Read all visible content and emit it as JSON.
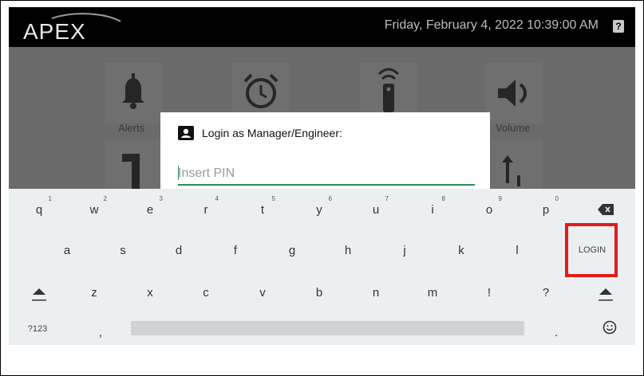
{
  "header": {
    "logo_text": "APEX",
    "datetime": "Friday, February 4, 2022 10:39:00 AM",
    "help_icon": "?"
  },
  "background_tiles": [
    {
      "icon": "bell-icon",
      "label": "Alerts"
    },
    {
      "icon": "alarm-clock-icon",
      "label": ""
    },
    {
      "icon": "remote-icon",
      "label": ""
    },
    {
      "icon": "volume-icon",
      "label": "Volume"
    },
    {
      "icon": "music-note-icon",
      "label": ""
    },
    {
      "icon": "sort-icon",
      "label": ""
    }
  ],
  "dialog": {
    "title": "Login as Manager/Engineer:",
    "icon": "person-badge-icon",
    "pin_placeholder": "Insert PIN",
    "pin_value": ""
  },
  "keyboard": {
    "row1": [
      {
        "key": "q",
        "hint": "1"
      },
      {
        "key": "w",
        "hint": "2"
      },
      {
        "key": "e",
        "hint": "3"
      },
      {
        "key": "r",
        "hint": "4"
      },
      {
        "key": "t",
        "hint": "5"
      },
      {
        "key": "y",
        "hint": "6"
      },
      {
        "key": "u",
        "hint": "7"
      },
      {
        "key": "i",
        "hint": "8"
      },
      {
        "key": "o",
        "hint": "9"
      },
      {
        "key": "p",
        "hint": "0"
      }
    ],
    "row2": [
      "a",
      "s",
      "d",
      "f",
      "g",
      "h",
      "j",
      "k",
      "l"
    ],
    "row3": [
      "z",
      "x",
      "c",
      "v",
      "b",
      "n",
      "m",
      "!",
      "?"
    ],
    "symbols_label": "?123",
    "comma": ",",
    "period": ".",
    "login_label": "LOGIN",
    "backspace_icon": "backspace-icon",
    "shift_icon": "shift-icon",
    "emoji_icon": "emoji-icon"
  },
  "colors": {
    "highlight": "#e21b1b",
    "input_accent": "#2e8b57",
    "keyboard_bg": "#eceff1"
  }
}
